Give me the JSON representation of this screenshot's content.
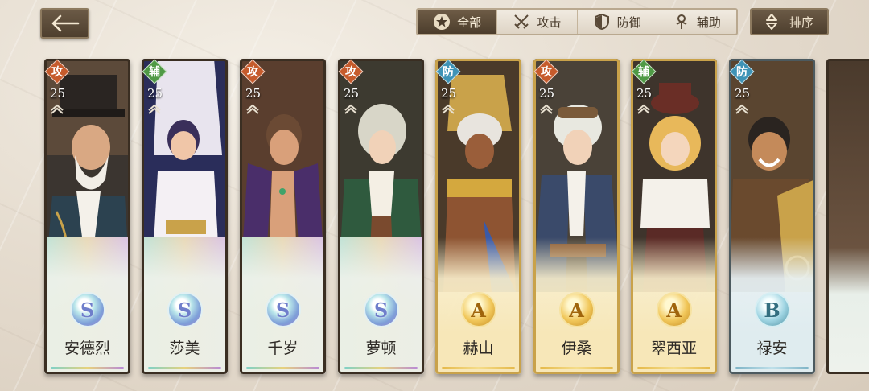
{
  "toolbar": {
    "back_icon": "arrow-left-icon",
    "filters": [
      {
        "label": "全部",
        "icon": "star-circle-icon",
        "active": true
      },
      {
        "label": "攻击",
        "icon": "crossed-swords-icon",
        "active": false
      },
      {
        "label": "防御",
        "icon": "shield-icon",
        "active": false
      },
      {
        "label": "辅助",
        "icon": "support-staff-icon",
        "active": false
      }
    ],
    "sort_label": "排序",
    "sort_icon": "sort-updown-icon"
  },
  "cards": [
    {
      "name": "安德烈",
      "role": "攻",
      "level": "25",
      "rank": "S"
    },
    {
      "name": "莎美",
      "role": "辅",
      "level": "25",
      "rank": "S"
    },
    {
      "name": "千岁",
      "role": "攻",
      "level": "25",
      "rank": "S"
    },
    {
      "name": "萝顿",
      "role": "攻",
      "level": "25",
      "rank": "S"
    },
    {
      "name": "赫山",
      "role": "防",
      "level": "25",
      "rank": "A"
    },
    {
      "name": "伊桑",
      "role": "攻",
      "level": "25",
      "rank": "A"
    },
    {
      "name": "翠西亚",
      "role": "辅",
      "level": "25",
      "rank": "A"
    },
    {
      "name": "禄安",
      "role": "防",
      "level": "25",
      "rank": "B"
    }
  ],
  "colors": {
    "attack": "#c65b2c",
    "support": "#4f9a45",
    "defense": "#3e93b6",
    "frame_dark": "#3a2e22",
    "button_brown": "#5a4936"
  }
}
